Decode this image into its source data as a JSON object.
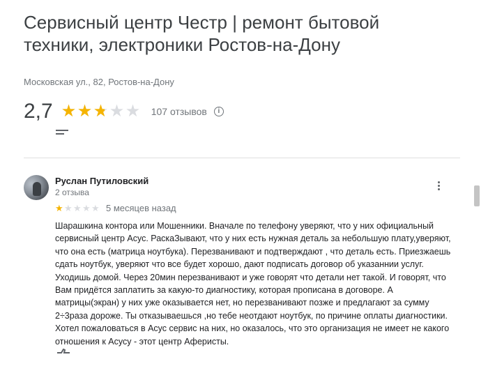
{
  "business": {
    "title": "Сервисный центр Честр | ремонт бытовой техники, электроники Ростов-на-Дону",
    "address": "Московская ул., 82, Ростов-на-Дону",
    "rating_text": "2,7",
    "rating_value": 2.7,
    "review_count": "107 отзывов"
  },
  "icons": {
    "info": "info-icon",
    "sort": "sort-icon",
    "menu": "more-vert-icon",
    "like": "thumb-up-icon"
  },
  "colors": {
    "star_filled": "#f5b400",
    "star_empty": "#dadce0",
    "text_secondary": "#70757a"
  },
  "review": {
    "author": "Руслан Путиловский",
    "author_meta": "2 отзыва",
    "rating_value": 1,
    "rating_max": 5,
    "date": "5 месяцев назад",
    "text_lines": [
      "Шарашкина контора или Мошенники. Вначале по телефону уверяют, что у них официальный",
      "сервисный центр Асус. РаскаЗывают, что у них есть нужная деталь за небольшую плату,уверяют,",
      "что она есть (матрица ноутбука). Перезванивают и подтверждают , что деталь есть. Приезжаешь",
      "сдать ноутбук, уверяют что все будет хорошо, дают подписать договор об указаннии услуг.",
      "Уходишь домой. Через 20мин перезванивают и уже говорят что детали нет такой. И говорят, что",
      "Вам придётся заплатить за какую-то диагностику, которая прописана в договоре. А",
      "матрицы(экран) у них уже оказывается нет, но перезванивают позже и предлагают за сумму",
      "2÷3раза дороже.  Ты отказываешься ,но тебе неотдают ноутбук, по причине оплаты диагностики.",
      "Хотел пожаловаться в Асус сервис на них, но оказалось, что это организация не имеет не какого",
      "отношения к Асусу - этот центр Аферисты."
    ]
  }
}
